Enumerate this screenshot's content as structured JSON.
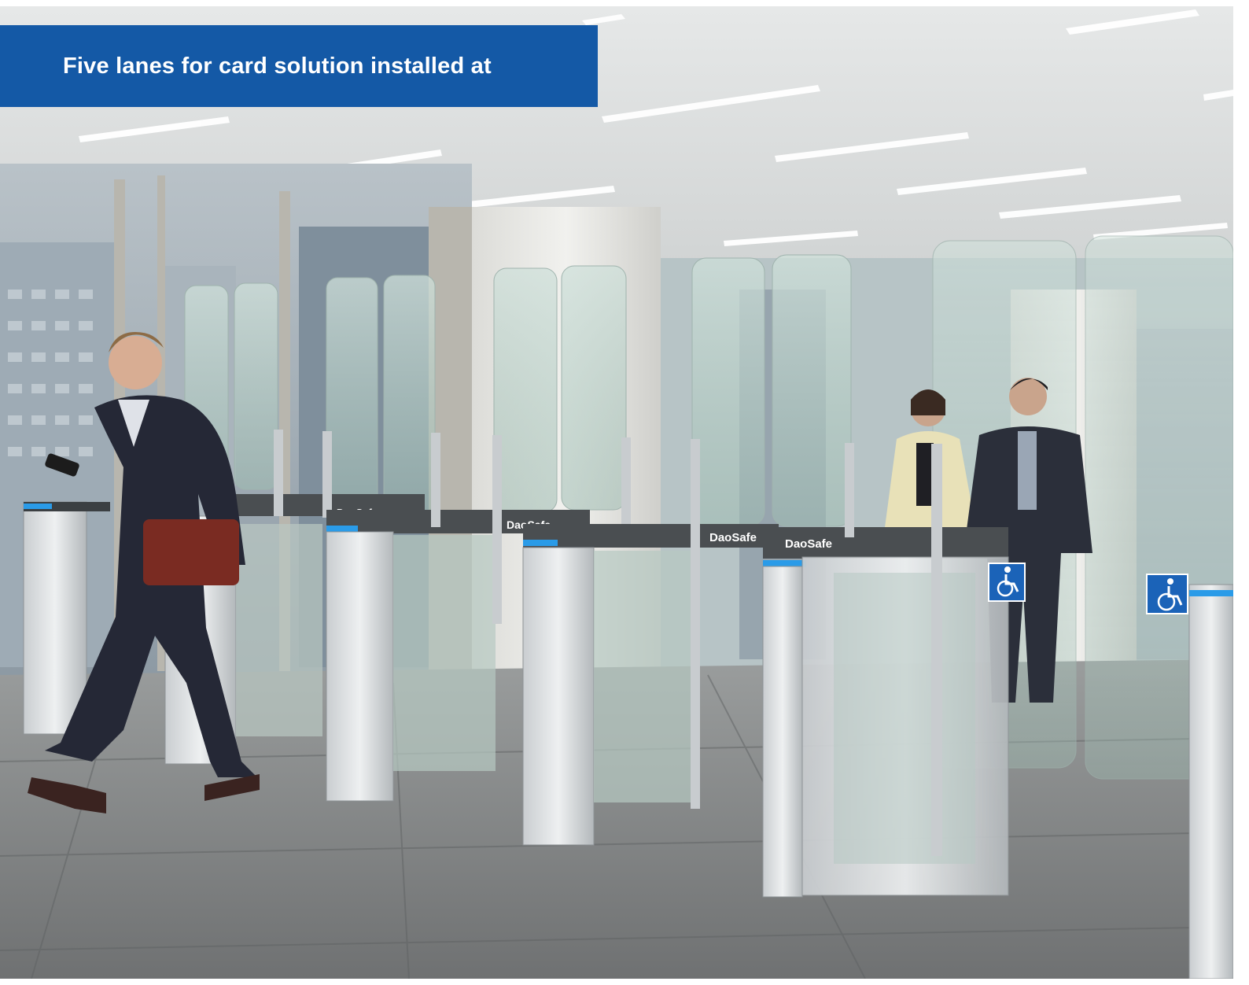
{
  "banner": {
    "title": "Five lanes for card solution installed at"
  },
  "photo": {
    "brand_label": "DaoSafe",
    "accent_light": "#2a9be8",
    "banner_color": "#1459a6",
    "accessibility_symbol": "wheelchair-icon"
  }
}
